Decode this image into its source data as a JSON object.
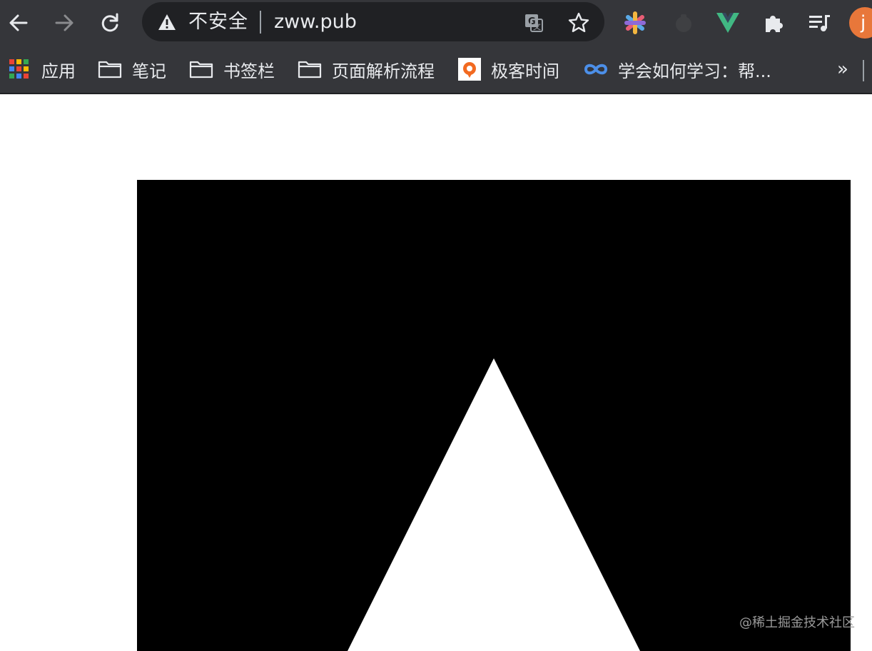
{
  "toolbar": {
    "back_icon": "arrow-left-icon",
    "forward_icon": "arrow-right-icon",
    "reload_icon": "reload-icon",
    "omnibox": {
      "security_icon": "warning-triangle-icon",
      "security_label": "不安全",
      "url": "zww.pub",
      "translate_icon": "translate-icon",
      "bookmark_icon": "star-icon"
    },
    "extensions": [
      {
        "name": "colorful-extension-icon"
      },
      {
        "name": "dark-extension-icon"
      },
      {
        "name": "vue-devtools-icon"
      },
      {
        "name": "puzzle-piece-icon"
      },
      {
        "name": "media-control-icon"
      }
    ],
    "avatar_initial": "j"
  },
  "bookmarks_bar": {
    "items": [
      {
        "label": "应用",
        "icon": "apps-grid-icon"
      },
      {
        "label": "笔记",
        "icon": "folder-icon"
      },
      {
        "label": "书签栏",
        "icon": "folder-icon"
      },
      {
        "label": "页面解析流程",
        "icon": "folder-icon"
      },
      {
        "label": "极客时间",
        "icon": "geektime-icon"
      },
      {
        "label": "学会如何学习：帮...",
        "icon": "coursera-icon"
      }
    ],
    "overflow_label": "»"
  },
  "page": {
    "watermark": "@稀土掘金技术社区"
  },
  "colors": {
    "chrome_bg": "#35363a",
    "omnibox_bg": "#202124",
    "text": "#e8eaed",
    "canvas_bg": "#000000",
    "shape_fill": "#ffffff",
    "avatar_bg": "#e8773a"
  }
}
